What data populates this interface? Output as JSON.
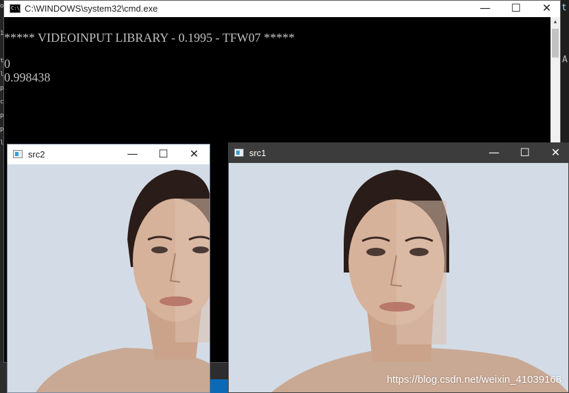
{
  "cmd_window": {
    "title": "C:\\WINDOWS\\system32\\cmd.exe",
    "icon": "cmd-icon",
    "icon_text": "C:\\",
    "buttons": {
      "minimize": "—",
      "maximize": "☐",
      "close": "✕"
    },
    "lines": [
      "***** VIDEOINPUT LIBRARY - 0.1995 - TFW07 *****",
      "",
      "0",
      "0.998438"
    ]
  },
  "src2_window": {
    "title": "src2",
    "icon": "opencv-window-icon",
    "buttons": {
      "minimize": "—",
      "maximize": "☐",
      "close": "✕"
    }
  },
  "src1_window": {
    "title": "src1",
    "icon": "opencv-window-icon",
    "buttons": {
      "minimize": "—",
      "maximize": "☐",
      "close": "✕"
    },
    "watermark": "https://blog.csdn.net/weixin_41039168"
  },
  "background": {
    "right_edge_text": "A",
    "right_edge_text2": "t"
  },
  "colors": {
    "console_bg": "#000000",
    "console_text": "#c0c0c0",
    "image_bg": "#d5dde6",
    "dark_titlebar": "#3c3c3c"
  }
}
